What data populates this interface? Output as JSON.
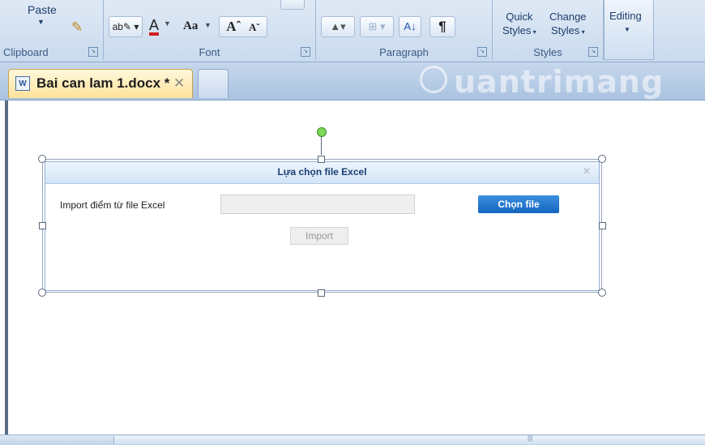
{
  "ribbon": {
    "clipboard": {
      "paste_label": "Paste",
      "group_label": "Clipboard"
    },
    "font": {
      "group_label": "Font",
      "change_case": "Aa",
      "grow": "A",
      "shrink": "A"
    },
    "paragraph": {
      "group_label": "Paragraph",
      "pilcrow": "¶"
    },
    "styles": {
      "group_label": "Styles",
      "quick_line1": "Quick",
      "quick_line2": "Styles",
      "change_line1": "Change",
      "change_line2": "Styles"
    },
    "editing": {
      "label": "Editing"
    }
  },
  "tabs": {
    "active_label": "Bai can lam 1.docx *",
    "close_glyph": "✕"
  },
  "watermark": {
    "text": "uantrimang"
  },
  "dialog": {
    "title": "Lựa chọn file Excel",
    "close_glyph": "✕",
    "import_label": "Import điểm từ file Excel",
    "file_input_value": "",
    "choose_button": "Chọn file",
    "import_button": "Import"
  },
  "colors": {
    "accent": "#1565c0",
    "ribbon": "#c9daee",
    "doc_tab": "#ffe29a"
  }
}
